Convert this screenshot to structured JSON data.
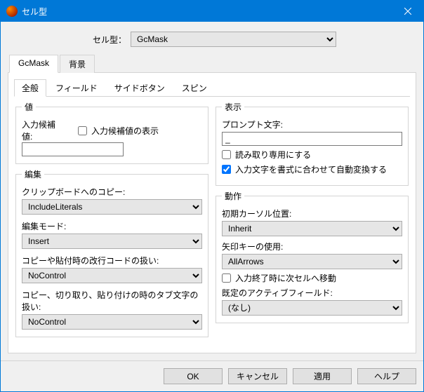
{
  "window": {
    "title": "セル型"
  },
  "celltype": {
    "label": "セル型：",
    "value": "GcMask"
  },
  "tabs": {
    "main": [
      "GcMask",
      "背景"
    ],
    "sub": [
      "全般",
      "フィールド",
      "サイドボタン",
      "スピン"
    ]
  },
  "groups": {
    "value": "値",
    "edit": "編集",
    "display": "表示",
    "action": "動作"
  },
  "value": {
    "candidate_label": "入力候補値:",
    "show_label": "入力候補値の表示",
    "show_checked": false,
    "candidate_value": ""
  },
  "edit": {
    "clipboard_label": "クリップボードへのコピー:",
    "clipboard": "IncludeLiterals",
    "editmode_label": "編集モード:",
    "editmode": "Insert",
    "newline_label": "コピーや貼付時の改行コードの扱い:",
    "newline": "NoControl",
    "tab_label": "コピー、切り取り、貼り付けの時のタブ文字の扱い:",
    "tab": "NoControl"
  },
  "display": {
    "prompt_label": "プロンプト文字:",
    "prompt": "_",
    "readonly_label": "読み取り専用にする",
    "readonly_checked": false,
    "autoconv_label": "入力文字を書式に合わせて自動変換する",
    "autoconv_checked": true
  },
  "action": {
    "cursor_label": "初期カーソル位置:",
    "cursor": "Inherit",
    "arrows_label": "矢印キーの使用:",
    "arrows": "AllArrows",
    "exitnext_label": "入力終了時に次セルへ移動",
    "exitnext_checked": false,
    "active_label": "既定のアクティブフィールド:",
    "active": "(なし)"
  },
  "buttons": {
    "ok": "OK",
    "cancel": "キャンセル",
    "apply": "適用",
    "help": "ヘルプ"
  }
}
